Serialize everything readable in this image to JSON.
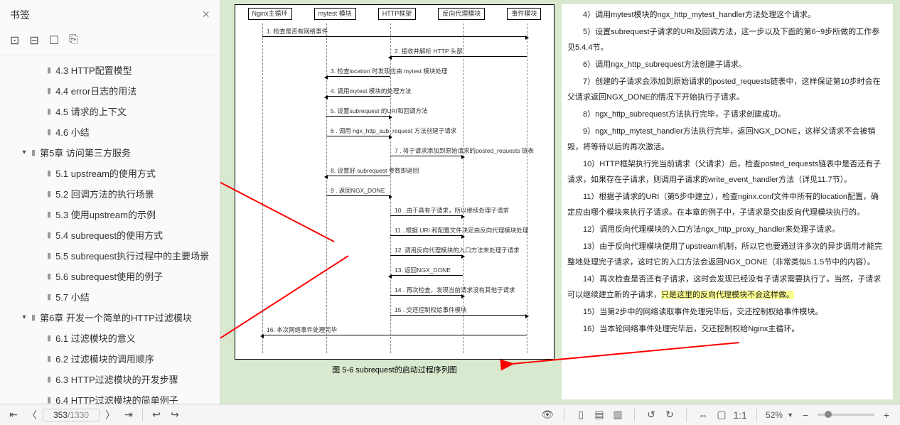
{
  "sidebar": {
    "title": "书签",
    "tree": [
      {
        "depth": 2,
        "label": "4.3 HTTP配置模型"
      },
      {
        "depth": 2,
        "label": "4.4 error日志的用法"
      },
      {
        "depth": 2,
        "label": "4.5 请求的上下文"
      },
      {
        "depth": 2,
        "label": "4.6 小结"
      },
      {
        "depth": 1,
        "expand": true,
        "label": "第5章 访问第三方服务"
      },
      {
        "depth": 2,
        "label": "5.1 upstream的使用方式"
      },
      {
        "depth": 2,
        "label": "5.2 回调方法的执行场景"
      },
      {
        "depth": 2,
        "label": "5.3 使用upstream的示例"
      },
      {
        "depth": 2,
        "label": "5.4 subrequest的使用方式"
      },
      {
        "depth": 2,
        "label": "5.5 subrequest执行过程中的主要场景"
      },
      {
        "depth": 2,
        "label": "5.6 subrequest使用的例子"
      },
      {
        "depth": 2,
        "label": "5.7 小结"
      },
      {
        "depth": 1,
        "expand": true,
        "label": "第6章 开发一个简单的HTTP过滤模块"
      },
      {
        "depth": 2,
        "label": "6.1 过滤模块的意义"
      },
      {
        "depth": 2,
        "label": "6.2 过滤模块的调用顺序"
      },
      {
        "depth": 2,
        "label": "6.3 HTTP过滤模块的开发步骤"
      },
      {
        "depth": 2,
        "label": "6.4 HTTP过滤模块的简单例子"
      }
    ]
  },
  "diagram": {
    "participants": [
      "Nginx主循环",
      "mytest 模块",
      "HTTP框架",
      "反向代理模块",
      "事件模块"
    ],
    "messages": [
      "1. 检查是否有网络事件",
      "2. 接收并解析 HTTP 头部",
      "3. 检查location 时发现应由 mytest 模块处理",
      "4. 调用mytest 模块的处理方法",
      "5. 设置subrequest 的URI和回调方法",
      "6 . 调用 ngx_http_sub_request 方法创建子请求",
      "7 . 将子请求添加到原始请求的posted_requests 链表",
      "8. 设置好 subrequest 参数即返回",
      "9 . 返回NGX_DONE",
      "10 . 由于具有子请求，所以继续处理子请求",
      "11 . 根据 URI 和配置文件决定由反向代理模块处理",
      "12. 调用反向代理模块的入口方法来处理子请求",
      "13. 返回NGX_DONE",
      "14 . 再次检查，发现当前请求没有其他子请求",
      "15 . 交还控制权给事件模块",
      "16. 本次网络事件处理完毕"
    ],
    "caption": "图 5-6  subrequest的启动过程序列图"
  },
  "text": {
    "paragraphs": [
      "4）调用mytest模块的ngx_http_mytest_handler方法处理这个请求。",
      "5）设置subrequest子请求的URI及回调方法，这一步以及下面的第6~9步所做的工作参见5.4.4节。",
      "6）调用ngx_http_subrequest方法创建子请求。",
      "7）创建的子请求会添加到原始请求的posted_requests链表中，这样保证第10步时会在父请求返回NGX_DONE的情况下开始执行子请求。",
      "8）ngx_http_subrequest方法执行完毕，子请求创建成功。",
      "9）ngx_http_mytest_handler方法执行完毕，返回NGX_DONE，这样父请求不会被销毁，将等待以后的再次激活。",
      "10）HTTP框架执行完当前请求（父请求）后，检查posted_requests链表中是否还有子请求，如果存在子请求，则调用子请求的write_event_handler方法（详见11.7节）。",
      "11）根据子请求的URI（第5步中建立），检查nginx.conf文件中所有的location配置，确定应由哪个模块来执行子请求。在本章的例子中，子请求是交由反向代理模块执行的。",
      "12）调用反向代理模块的入口方法ngx_http_proxy_handler来处理子请求。",
      "13）由于反向代理模块使用了upstream机制，所以它也要通过许多次的异步调用才能完整地处理完子请求，这时它的入口方法会返回NGX_DONE（非常类似5.1.5节中的内容）。",
      "14）再次检查是否还有子请求，这时会发现已经没有子请求需要执行了。当然，子请求可以继续建立新的子请求，",
      "15）当第2步中的网络读取事件处理完毕后，交还控制权给事件模块。",
      "16）当本轮网络事件处理完毕后，交还控制权给Nginx主循环。"
    ],
    "highlight": "只是这里的反向代理模块不会这样做。"
  },
  "toolbar": {
    "page_current": "353",
    "page_total": "1330",
    "zoom": "52%"
  }
}
